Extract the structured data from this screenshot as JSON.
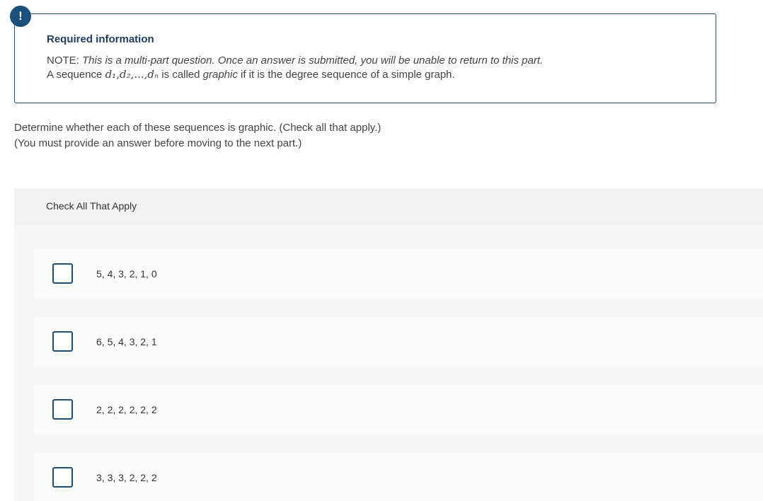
{
  "alert": {
    "icon": "exclamation-icon",
    "glyph": "!"
  },
  "required_info": {
    "title": "Required information",
    "note_prefix": "NOTE: ",
    "note_italic": "This is a multi-part question. Once an answer is submitted, you will be unable to return to this part.",
    "def_prefix": "A sequence ",
    "def_sequence": "d₁,d₂,...,dₙ",
    "def_middle": " is called ",
    "def_term": "graphic",
    "def_suffix": " if it is the degree sequence of a simple graph."
  },
  "question": {
    "prompt": "Determine whether each of these sequences is graphic. (Check all that apply.)",
    "requirement": "(You must provide an answer before moving to the next part.)"
  },
  "check_all": {
    "header": "Check All That Apply",
    "options": [
      {
        "label": "5, 4, 3, 2, 1, 0",
        "checked": false
      },
      {
        "label": "6, 5, 4, 3, 2, 1",
        "checked": false
      },
      {
        "label": "2, 2, 2, 2, 2, 2",
        "checked": false
      },
      {
        "label": "3, 3, 3, 2, 2, 2",
        "checked": false
      }
    ]
  },
  "colors": {
    "accent": "#1b4f7c",
    "header_bg": "#f2f2f2",
    "option_bg": "#fafafa"
  }
}
